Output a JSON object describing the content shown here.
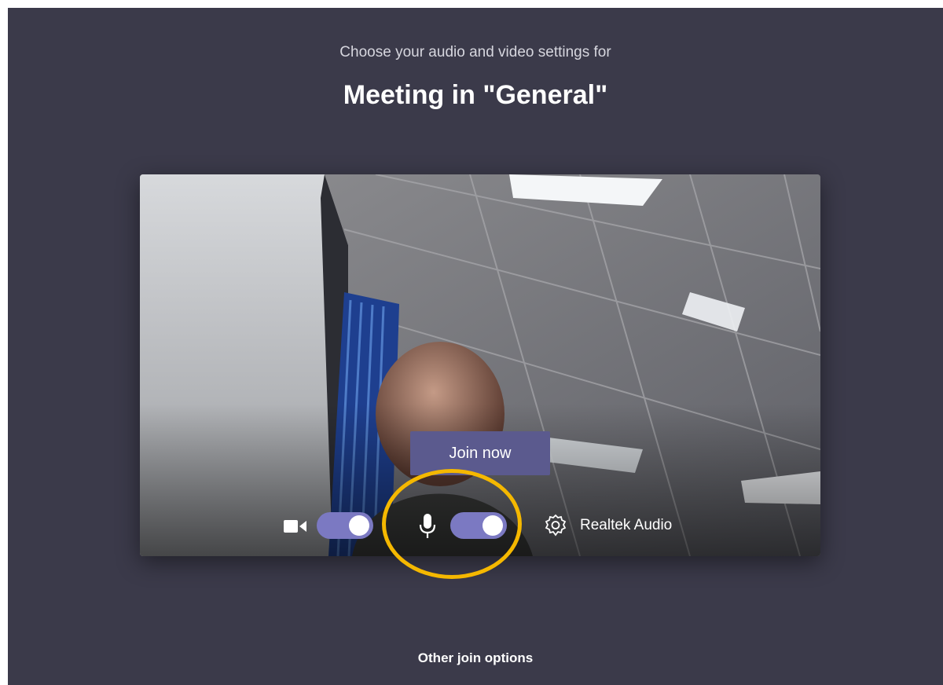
{
  "header": {
    "subtitle": "Choose your audio and video settings for",
    "meeting_title": "Meeting in \"General\""
  },
  "preview": {
    "join_button_label": "Join now",
    "controls": {
      "camera": {
        "icon": "camera-icon",
        "enabled": true
      },
      "microphone": {
        "icon": "microphone-icon",
        "enabled": true
      },
      "device_settings": {
        "icon": "gear-icon",
        "label": "Realtek Audio"
      }
    }
  },
  "footer": {
    "other_join_options": "Other join options"
  },
  "colors": {
    "background": "#3b3a4a",
    "toggle_on": "#7b79c2",
    "join_button": "#5b5a8e",
    "highlight": "#f5b800"
  }
}
